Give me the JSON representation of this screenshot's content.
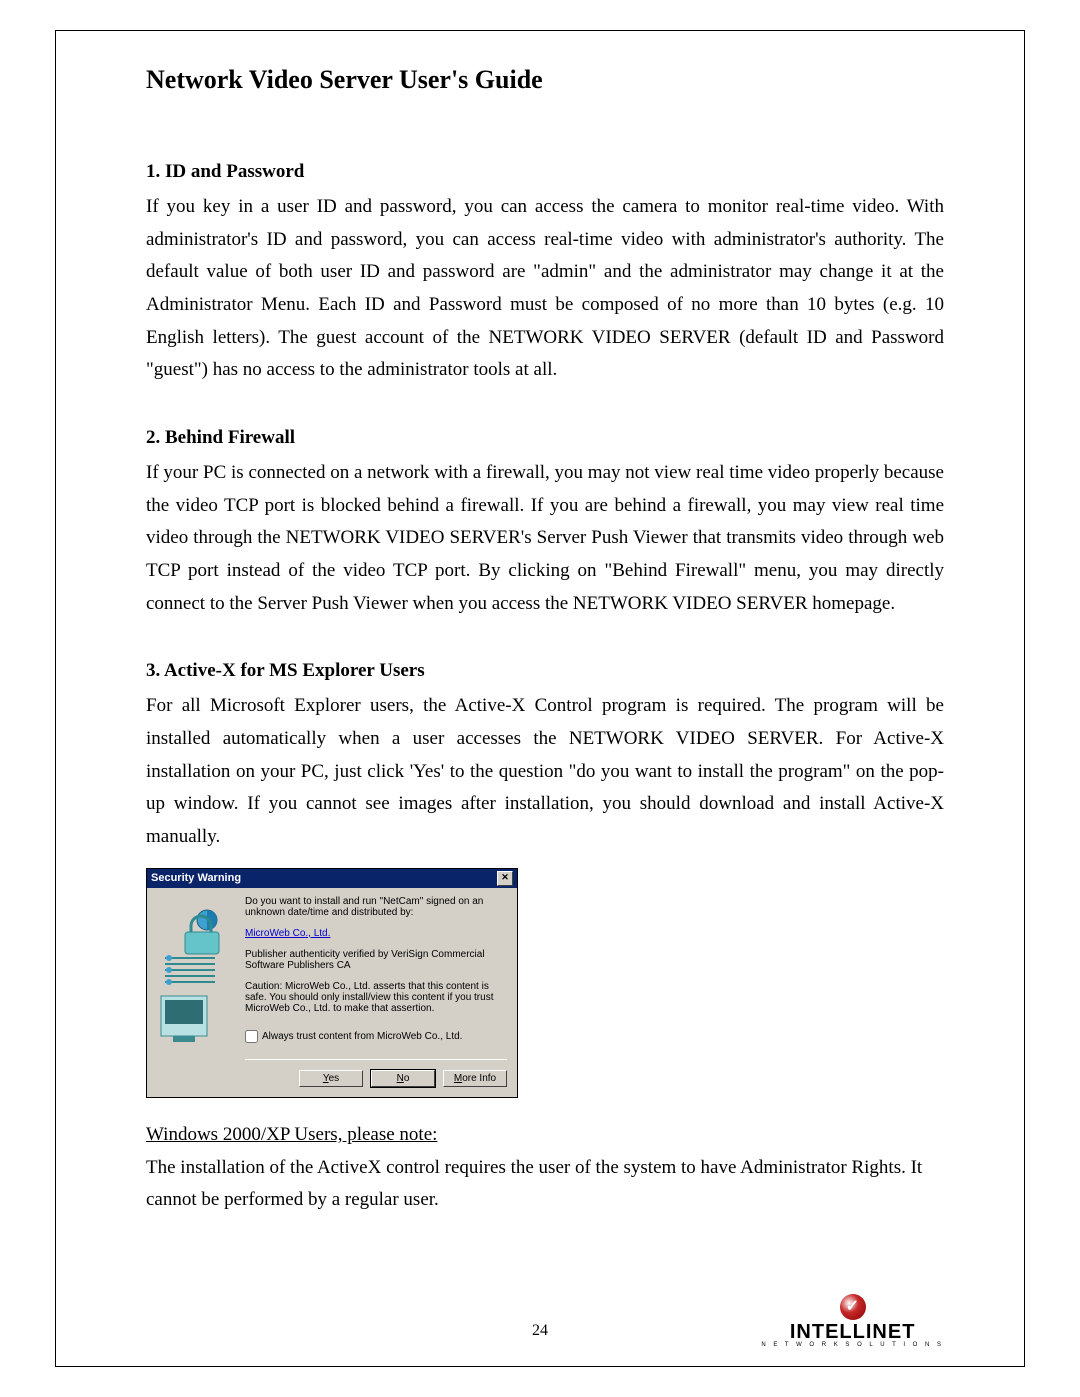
{
  "doc_title": "Network Video Server User's Guide",
  "page_number": "24",
  "brand": {
    "name": "INTELLINET",
    "sub": "N E T W O R K   S O L U T I O N S"
  },
  "sections": [
    {
      "heading": "1. ID and Password",
      "body": "If you key in a user ID and password, you can access the camera to monitor real-time video. With administrator's ID and password, you can access real-time video with administrator's authority. The default value of both user ID and password are \"admin\" and the administrator may change it at the Administrator Menu. Each ID and Password must be composed of no more than 10 bytes (e.g. 10 English letters).  The guest account of the NETWORK VIDEO SERVER (default ID and Password \"guest\") has no access to the administrator tools at all."
    },
    {
      "heading": "2. Behind Firewall",
      "body": "If your PC is connected on a network with a firewall, you may not view real time video properly because the video TCP port is blocked behind a firewall. If you are behind a firewall, you may view real time video through the NETWORK VIDEO SERVER's Server Push Viewer that transmits video through web TCP port instead of the video TCP port. By clicking on \"Behind Firewall\" menu, you may directly connect to the Server Push Viewer when you access the NETWORK VIDEO SERVER homepage."
    },
    {
      "heading": "3. Active-X for MS Explorer Users",
      "body": "For all Microsoft Explorer users, the Active-X Control program is required. The program will be installed automatically when a user accesses the NETWORK VIDEO SERVER. For Active-X installation on your PC, just click 'Yes' to the question \"do you want to install the program\" on the pop-up window. If you cannot see images after installation, you should download and install Active-X manually."
    }
  ],
  "dialog": {
    "title": "Security Warning",
    "line1": "Do you want to install and run \"NetCam\" signed on an unknown date/time and distributed by:",
    "publisher": "MicroWeb Co., Ltd.",
    "verify": "Publisher authenticity verified by VeriSign Commercial Software Publishers CA",
    "caution": "Caution: MicroWeb Co., Ltd. asserts that this content is safe. You should only install/view this content if you trust MicroWeb Co., Ltd. to make that assertion.",
    "trust": "Always trust content from MicroWeb Co., Ltd.",
    "yes": "Yes",
    "no": "No",
    "more": "More Info"
  },
  "note": {
    "heading": "Windows 2000/XP Users, please note: ",
    "body": "The installation of the ActiveX control requires the user of the system to have Administrator Rights. It cannot be performed by a regular user."
  }
}
